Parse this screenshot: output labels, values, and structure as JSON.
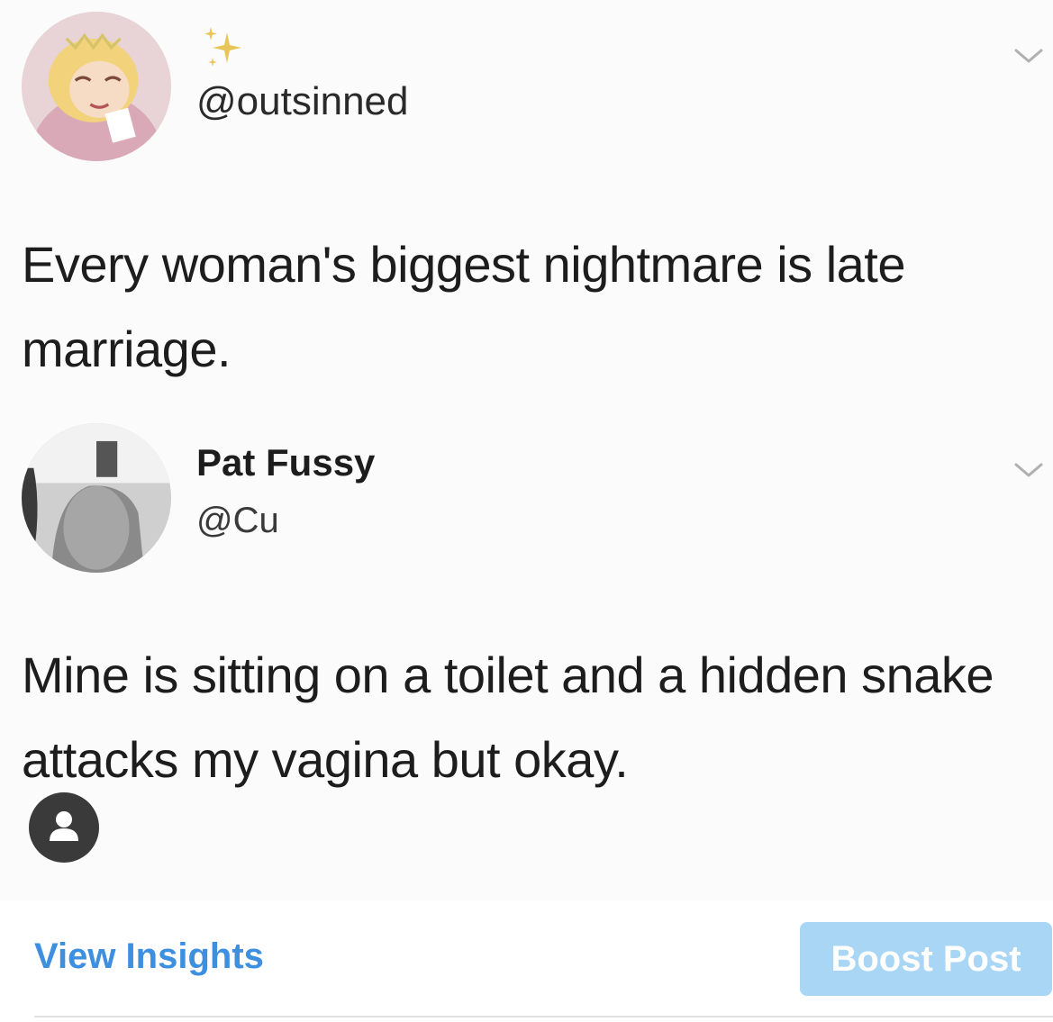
{
  "tweet": {
    "author_handle": "@outsinned",
    "text": "Every woman's biggest nightmare is late marriage."
  },
  "reply": {
    "display_name": "Pat Fussy",
    "handle": "@Cu",
    "text": "Mine is sitting on a toilet and a hidden snake attacks my vagina but okay."
  },
  "post_actions": {
    "view_insights_label": "View Insights",
    "boost_post_label": "Boost Post"
  },
  "icons": {
    "sparkle": "sparkle-icon",
    "chevron": "chevron-down-icon",
    "profile": "user-icon"
  },
  "colors": {
    "link": "#3d8fe0",
    "boost_button_bg": "#a9d6f5",
    "boost_button_text": "#ffffff",
    "text": "#1d1d1d"
  }
}
